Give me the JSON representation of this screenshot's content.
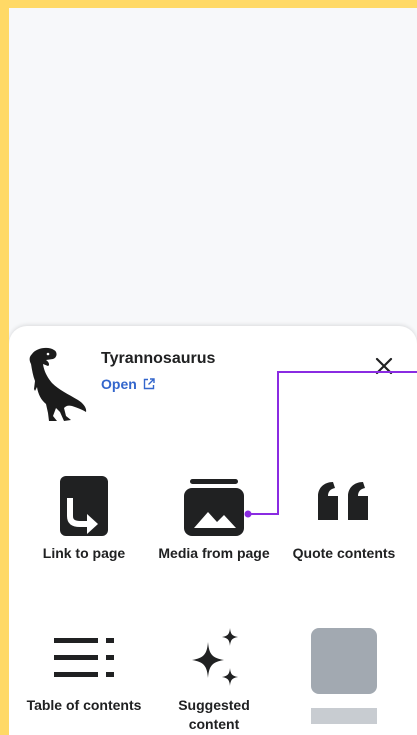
{
  "article": {
    "title": "Tyrannosaurus",
    "open_label": "Open"
  },
  "icons": {
    "dinosaur": "dinosaur-silhouette-icon",
    "external": "external-link-icon",
    "close": "close-icon"
  },
  "tiles": [
    {
      "label": "Link to page",
      "icon": "link-to-page-icon"
    },
    {
      "label": "Media from page",
      "icon": "image-icon"
    },
    {
      "label": "Quote contents",
      "icon": "quote-icon"
    },
    {
      "label": "Table of contents",
      "icon": "table-of-contents-icon"
    },
    {
      "label": "Suggested content",
      "icon": "sparkles-icon"
    },
    {
      "label": "",
      "icon": "loading-placeholder"
    }
  ],
  "colors": {
    "frame": "#ffd966",
    "link": "#3366cc",
    "connector": "#8a2be2",
    "placeholder": "#a2a9b1"
  }
}
